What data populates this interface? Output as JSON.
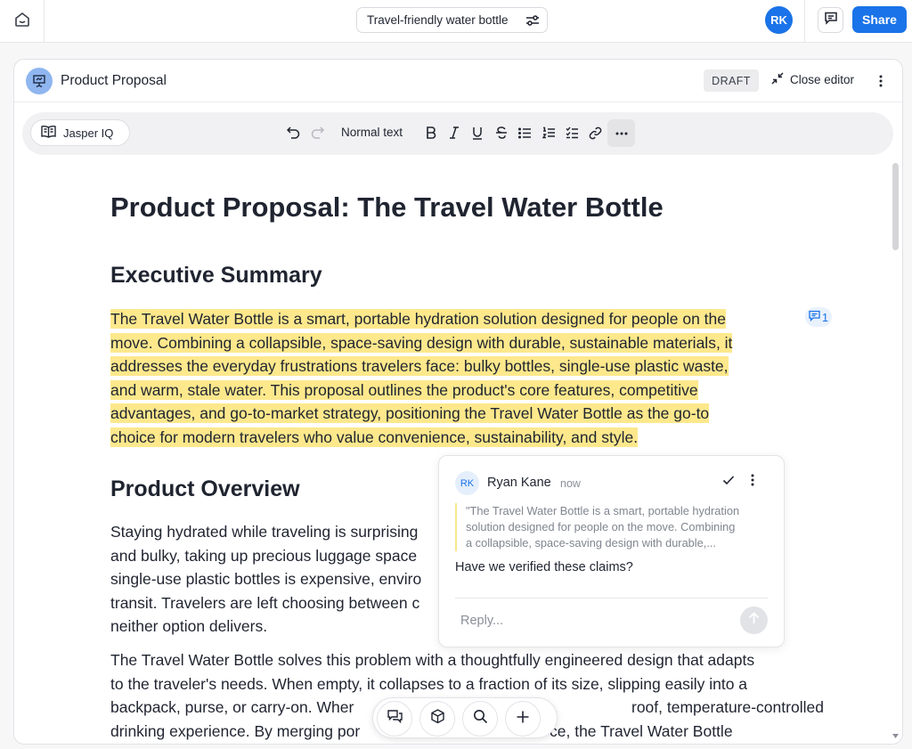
{
  "topbar": {
    "home_icon": "home-icon",
    "topic": "Travel-friendly water bottle",
    "topic_icon": "sliders-icon",
    "avatar_initials": "RK",
    "comments_icon": "comment-icon",
    "share_label": "Share"
  },
  "editor": {
    "doc_icon": "presentation-icon",
    "title": "Product Proposal",
    "status_badge": "DRAFT",
    "close_label": "Close editor"
  },
  "toolbar": {
    "jasper_label": "Jasper IQ",
    "text_style": "Normal text",
    "icons": [
      "undo-icon",
      "redo-icon",
      "bold-icon",
      "italic-icon",
      "underline-icon",
      "strikethrough-icon",
      "bullet-list-icon",
      "numbered-list-icon",
      "checklist-icon",
      "link-icon",
      "more-icon"
    ]
  },
  "document": {
    "title": "Product Proposal: The Travel Water Bottle",
    "sections": [
      {
        "heading": "Executive Summary",
        "paragraphs": [
          {
            "lines": [
              "The Travel Water Bottle is a smart, portable hydration solution designed for people on the",
              "move. Combining a collapsible, space-saving design with durable, sustainable materials, it",
              "addresses the everyday frustrations travelers face: bulky bottles, single-use plastic waste,",
              "and warm, stale water. This proposal outlines the product's core features, competitive",
              "advantages, and go-to-market strategy, positioning the Travel Water Bottle as the go-to",
              "choice for modern travelers who value convenience, sustainability, and style."
            ]
          }
        ]
      },
      {
        "heading": "Product Overview",
        "paragraphs": [
          {
            "lines": [
              "Staying hydrated while traveling is surprising",
              "and bulky, taking up precious luggage space",
              "single-use plastic bottles is expensive, enviro",
              "transit. Travelers are left choosing between c",
              "neither option delivers."
            ]
          },
          {
            "lines": [
              "The Travel Water Bottle solves this problem with a thoughtfully engineered design that adapts",
              "to the traveler's needs. When empty, it collapses to a fraction of its size, slipping easily into a",
              "backpack, purse, or carry-on. Wher",
              "drinking experience. By merging por"
            ],
            "line3_tail": "roof, temperature-controlled",
            "line4_tail": "ce, the Travel Water Bottle"
          }
        ]
      }
    ],
    "comment_count": "1"
  },
  "comment": {
    "author_initials": "RK",
    "author": "Ryan Kane",
    "time": "now",
    "quote_lines": [
      "\"The Travel Water Bottle is a smart, portable hydration",
      "solution designed for people on the move. Combining",
      "a collapsible, space-saving design with durable,..."
    ],
    "message": "Have we verified these claims?",
    "reply_placeholder": "Reply..."
  },
  "floating_toolbar": {
    "icons": [
      "chat-icon",
      "cube-icon",
      "search-icon",
      "plus-icon"
    ]
  },
  "colors": {
    "accent": "#1a73e8",
    "highlight": "#fde88c"
  }
}
